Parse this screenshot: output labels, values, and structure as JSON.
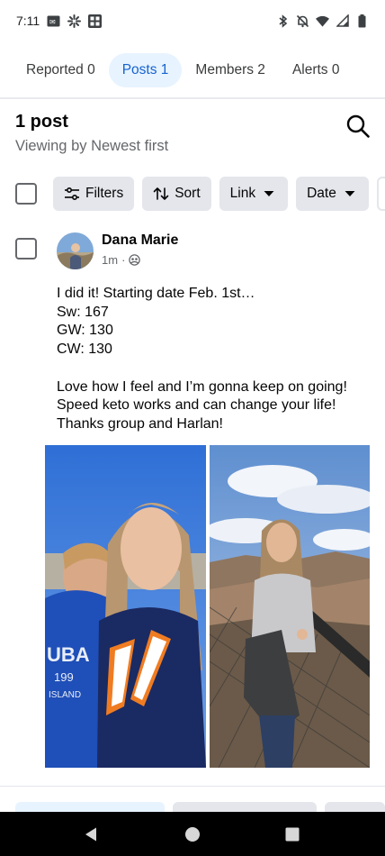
{
  "status_bar": {
    "time": "7:11",
    "left_icons": [
      "cast-icon",
      "pinwheel-icon",
      "app-grid-icon"
    ],
    "right_icons": [
      "bluetooth-icon",
      "mute-icon",
      "wifi-icon",
      "signal-icon",
      "battery-icon"
    ]
  },
  "tabs": [
    {
      "label": "Reported 0",
      "active": false
    },
    {
      "label": "Posts 1",
      "active": true
    },
    {
      "label": "Members 2",
      "active": false
    },
    {
      "label": "Alerts 0",
      "active": false
    }
  ],
  "header": {
    "count": "1 post",
    "sort_description": "Viewing by Newest first"
  },
  "filters": {
    "chips": [
      {
        "label": "Filters",
        "icon": "sliders-icon"
      },
      {
        "label": "Sort",
        "icon": "sort-arrows-icon"
      },
      {
        "label": "Link",
        "icon": "caret-down-icon"
      },
      {
        "label": "Date",
        "icon": "caret-down-icon"
      }
    ]
  },
  "post": {
    "author": "Dana Marie",
    "time": "1m",
    "separator": "·",
    "privacy_icon": "group-icon",
    "text": "I did it! Starting date Feb. 1st…\nSw: 167\nGW: 130\nCW: 130\n\nLove how I feel and I’m gonna keep on going! Speed keto works and can change your life! Thanks group and Harlan!",
    "photos": [
      "selfie-photo",
      "canyon-photo"
    ]
  },
  "colors": {
    "accent": "#1763cf",
    "accent_bg": "#e7f3ff",
    "chip_bg": "#e4e6eb",
    "secondary_text": "#65676b"
  }
}
